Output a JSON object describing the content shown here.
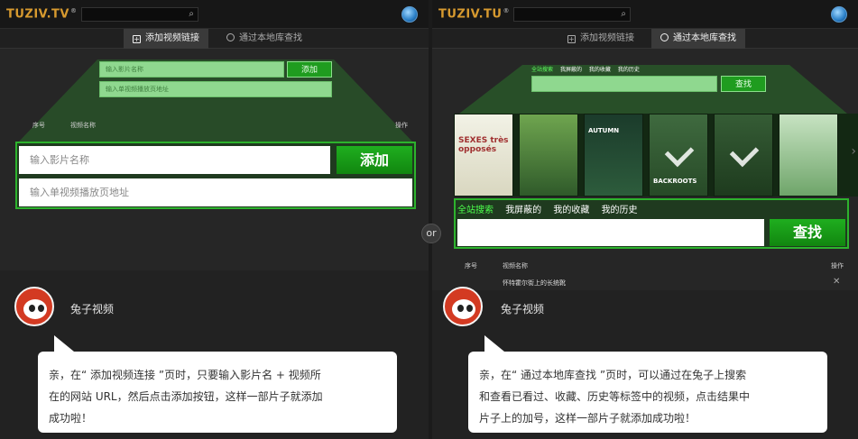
{
  "or_label": "or",
  "colors": {
    "accent_green": "#2db32d",
    "button_green": "#1f9c1f",
    "logo_orange": "#d79a2f",
    "avatar_red": "#d33a22"
  },
  "left": {
    "logo": "TUZIV.TV",
    "logo_mark": "®",
    "search_icon": "search-icon",
    "tabs": [
      {
        "label": "添加视频链接",
        "icon": "plus-square-icon",
        "active": true
      },
      {
        "label": "通过本地库查找",
        "icon": "search-icon",
        "active": false
      }
    ],
    "mini_form": {
      "name_placeholder": "输入影片名称",
      "add_label": "添加",
      "url_placeholder": "输入单视频播放页地址"
    },
    "table_header": {
      "col_index": "序号",
      "col_name": "视频名称",
      "col_action": "操作"
    },
    "big_form": {
      "name_placeholder": "输入影片名称",
      "add_label": "添加",
      "url_placeholder": "输入单视频播放页地址"
    },
    "brand": "兔子视频",
    "bubble_lines": [
      "亲，在“ 添加视频连接 ”页时，只要输入影片名 + 视频所",
      "在的网站 URL，然后点击添加按钮，这样一部片子就添加",
      "成功啦！"
    ]
  },
  "right": {
    "logo": "TUZIV.TU",
    "logo_mark": "®",
    "tabs": [
      {
        "label": "添加视频链接",
        "icon": "plus-square-icon",
        "active": false
      },
      {
        "label": "通过本地库查找",
        "icon": "search-icon",
        "active": true
      }
    ],
    "mini_filters": [
      "全站搜索",
      "我屏蔽的",
      "我的收藏",
      "我的历史"
    ],
    "mini_search_label": "查找",
    "posters": [
      {
        "title": "SEXES très opposés",
        "checked": false
      },
      {
        "title": "",
        "checked": false
      },
      {
        "title": "AUTUMN",
        "checked": false
      },
      {
        "title": "BACKROOTS",
        "checked": true
      },
      {
        "title": "",
        "checked": true
      },
      {
        "title": "",
        "checked": false
      }
    ],
    "filters": [
      "全站搜索",
      "我屏蔽的",
      "我的收藏",
      "我的历史"
    ],
    "search_label": "查找",
    "table_header": {
      "col_index": "序号",
      "col_name": "视频名称",
      "col_action": "操作"
    },
    "row_title": "怀特霍尔街上的长统靴",
    "brand": "兔子视频",
    "bubble_lines": [
      "亲，在“ 通过本地库查找 ”页时，可以通过在兔子上搜索",
      "和查看已看过、收藏、历史等标签中的视频，点击结果中",
      "片子上的加号，这样一部片子就添加成功啦！"
    ]
  }
}
